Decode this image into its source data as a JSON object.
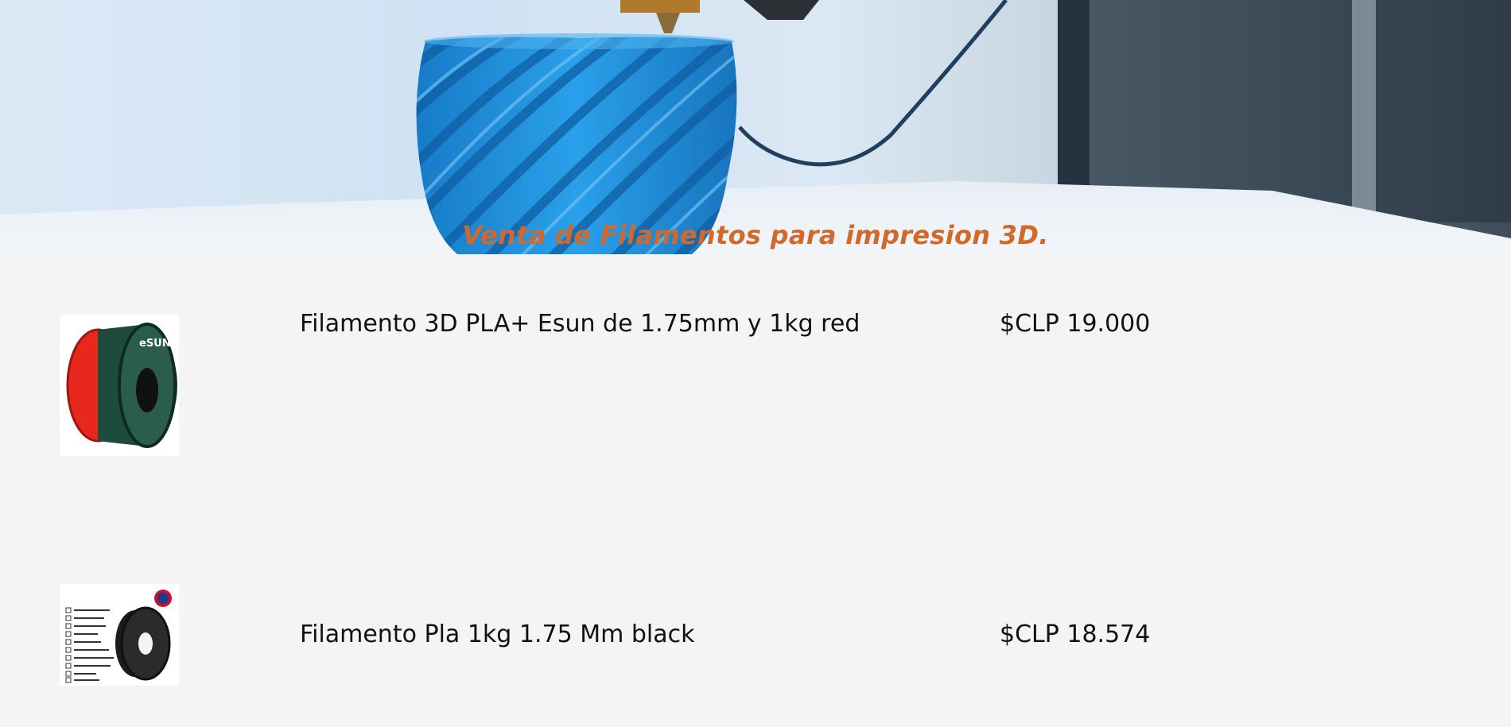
{
  "hero": {
    "title": "Venta de Filamentos para impresion 3D."
  },
  "products": [
    {
      "name": "Filamento 3D PLA+ Esun de 1.75mm y 1kg red",
      "price": "$CLP 19.000",
      "thumb_label": "eSUN",
      "image_icon": "red-filament-spool-icon"
    },
    {
      "name": "Filamento Pla 1kg 1.75 Mm black",
      "price": "$CLP 18.574",
      "image_icon": "black-filament-spool-icon"
    }
  ],
  "colors": {
    "title": "#d2692a",
    "page_bg": "#f4f4f4",
    "hero_object": "#1e90d8"
  }
}
